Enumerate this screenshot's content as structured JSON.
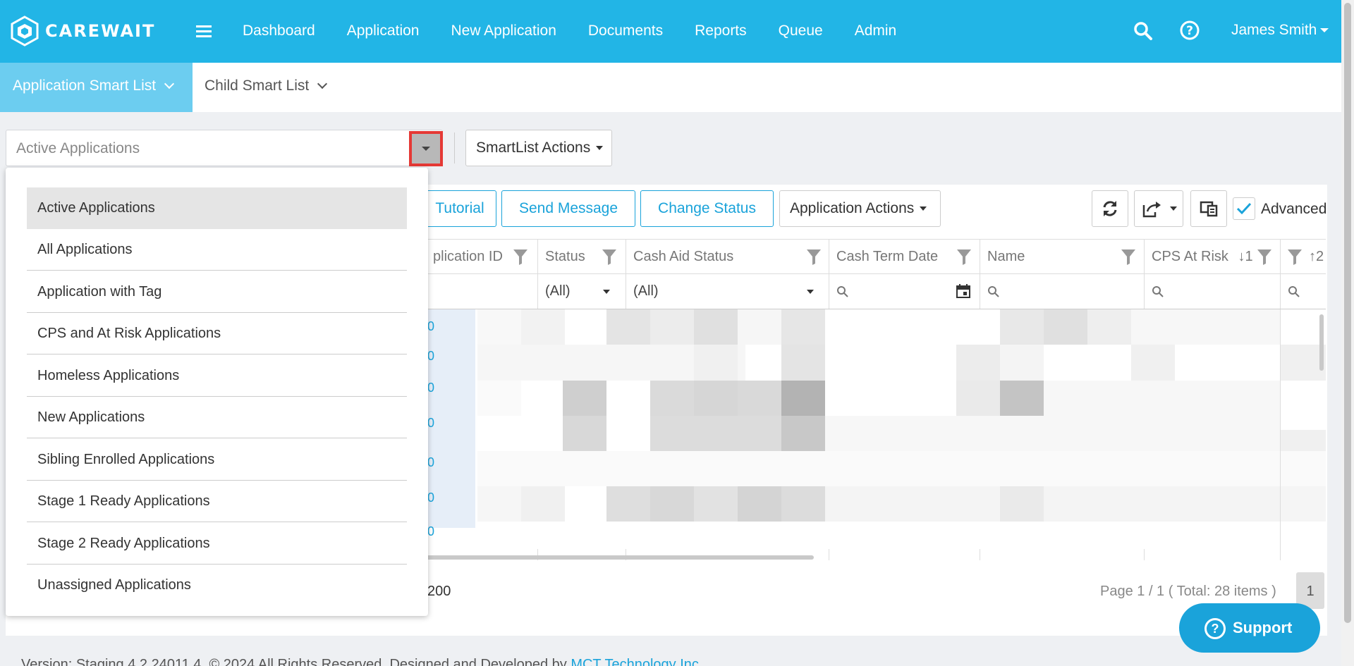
{
  "app": {
    "logo_text": "CAREWAIT"
  },
  "nav": {
    "links": [
      "Dashboard",
      "Application",
      "New Application",
      "Documents",
      "Reports",
      "Queue",
      "Admin"
    ],
    "user": "James Smith"
  },
  "subtabs": {
    "active": "Application Smart List",
    "other": "Child Smart List"
  },
  "smartlist": {
    "selected": "Active Applications",
    "actions_label": "SmartList Actions",
    "options": [
      "Active Applications",
      "All Applications",
      "Application with Tag",
      "CPS and At Risk Applications",
      "Homeless Applications",
      "New Applications",
      "Sibling Enrolled Applications",
      "Stage 1 Ready Applications",
      "Stage 2 Ready Applications",
      "Unassigned Applications"
    ]
  },
  "toolbar": {
    "tutorial": "Tutorial",
    "send_message": "Send Message",
    "change_status": "Change Status",
    "application_actions": "Application Actions",
    "advanced": "Advanced"
  },
  "grid": {
    "columns": [
      "plication ID",
      "Status",
      "Cash Aid Status",
      "Cash Term Date",
      "Name",
      "CPS At Risk",
      "↑2"
    ],
    "cps_sort": "↓1",
    "filters": {
      "status": "(All)",
      "cash_aid_status": "(All)"
    },
    "row_links": [
      "0",
      "0",
      "0",
      "0",
      "0",
      "0",
      "0"
    ]
  },
  "pager": {
    "page_size": "200",
    "info": "Page 1 / 1 ( Total: 28 items )",
    "page": "1"
  },
  "support": "Support",
  "footer": {
    "text": "Version: Staging 4.2.24011.4, © 2024 All Rights Reserved. Designed and Developed by ",
    "link": "MCT Technology Inc"
  },
  "colors": {
    "brand": "#22b5e6",
    "accent": "#1aa3da",
    "highlight": "#e53935"
  }
}
